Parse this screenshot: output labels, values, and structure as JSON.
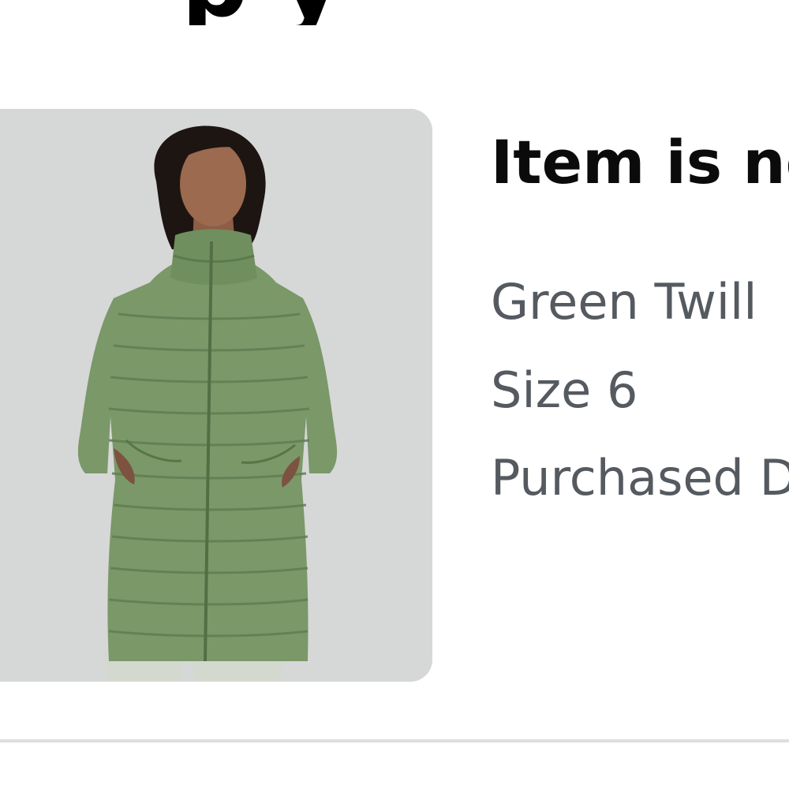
{
  "heading": {
    "text": "p y"
  },
  "product": {
    "image_alt": "Green quilted long down jacket",
    "status": "Item is no",
    "color": "Green Twill",
    "size": "Size 6",
    "purchased": "Purchased D"
  },
  "colors": {
    "card_background": "#d5d6d6",
    "jacket": "#7a9868",
    "status_text": "#0b0b0b",
    "secondary_text": "#555a60",
    "divider": "#dedede"
  }
}
